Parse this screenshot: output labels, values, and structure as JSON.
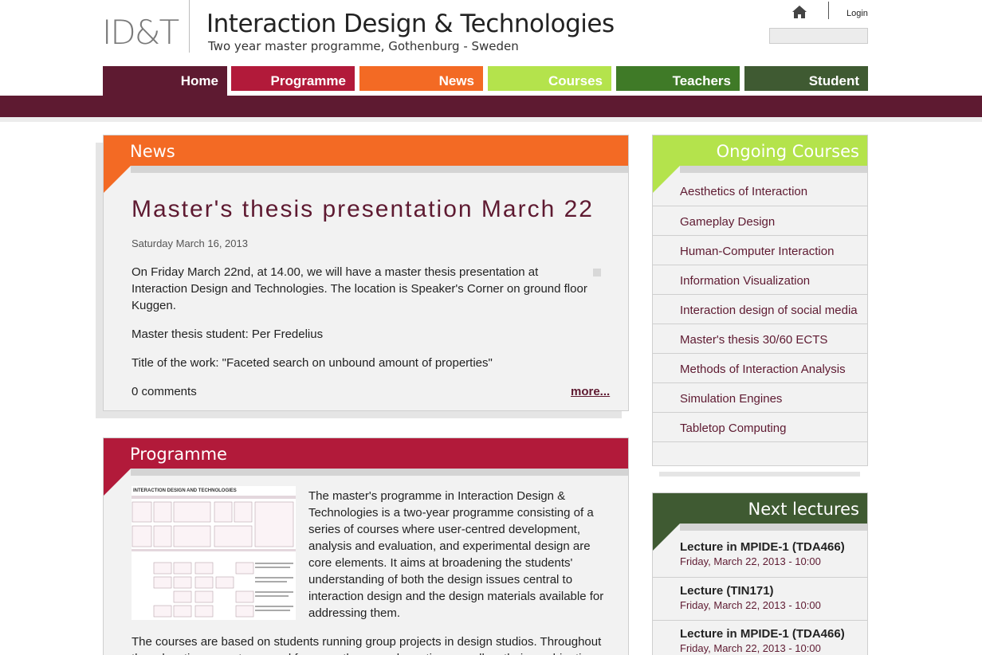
{
  "header": {
    "logo": "ID&T",
    "site_title": "Interaction Design & Technologies",
    "site_subtitle": "Two year master programme, Gothenburg - Sweden",
    "home_icon": "home-icon",
    "login_label": "Login",
    "search_value": ""
  },
  "nav": {
    "tabs": [
      {
        "label": "Home",
        "color": "#5e1a31",
        "active": true
      },
      {
        "label": "Programme",
        "color": "#b21a3a"
      },
      {
        "label": "News",
        "color": "#f36a24"
      },
      {
        "label": "Courses",
        "color": "#b4e34c"
      },
      {
        "label": "Teachers",
        "color": "#3f7a27"
      },
      {
        "label": "Student",
        "color": "#3f5a32"
      }
    ]
  },
  "news": {
    "heading": "News",
    "title": "Master's thesis presentation March 22",
    "date": "Saturday March 16, 2013",
    "paragraphs": [
      "On Friday March 22nd, at 14.00, we will have a master thesis presentation at Interaction Design and Technologies. The location is Speaker's Corner on ground floor Kuggen.",
      "Master thesis student: Per Fredelius",
      "Title of the work: \"Faceted search on unbound amount of properties\""
    ],
    "comments": "0 comments",
    "more_label": "more..."
  },
  "programme": {
    "heading": "Programme",
    "diagram_title": "INTERACTION DESIGN AND TECHNOLOGIES",
    "paragraph1": "The master's programme in Interaction Design & Technologies is a two-year programme consisting of a series of courses where user-centred development, analysis and evaluation, and experimental design are core elements. It aims at broadening the students' understanding of both the design issues central to interaction design and the design materials available for addressing them.",
    "paragraph2": "The courses are based on students running group projects in design studios. Throughout the education we put an equal focus on theory and practice as well as their combination."
  },
  "ongoing_courses": {
    "heading": "Ongoing Courses",
    "items": [
      "Aesthetics of Interaction",
      "Gameplay Design",
      "Human-Computer Interaction",
      "Information Visualization",
      "Interaction design of social media",
      "Master's thesis 30/60 ECTS",
      "Methods of Interaction Analysis",
      "Simulation Engines",
      "Tabletop Computing"
    ]
  },
  "next_lectures": {
    "heading": "Next lectures",
    "items": [
      {
        "title": "Lecture in MPIDE-1 (TDA466)",
        "date": "Friday, March 22, 2013 - 10:00"
      },
      {
        "title": "Lecture (TIN171)",
        "date": "Friday, March 22, 2013 - 10:00"
      },
      {
        "title": "Lecture in MPIDE-1 (TDA466)",
        "date": "Friday, March 22, 2013 - 10:00"
      }
    ]
  },
  "colors": {
    "brand": "#5e1a31",
    "news": "#f36a24",
    "programme": "#b21a3a",
    "courses": "#b4e34c",
    "lectures": "#3f5a32"
  }
}
